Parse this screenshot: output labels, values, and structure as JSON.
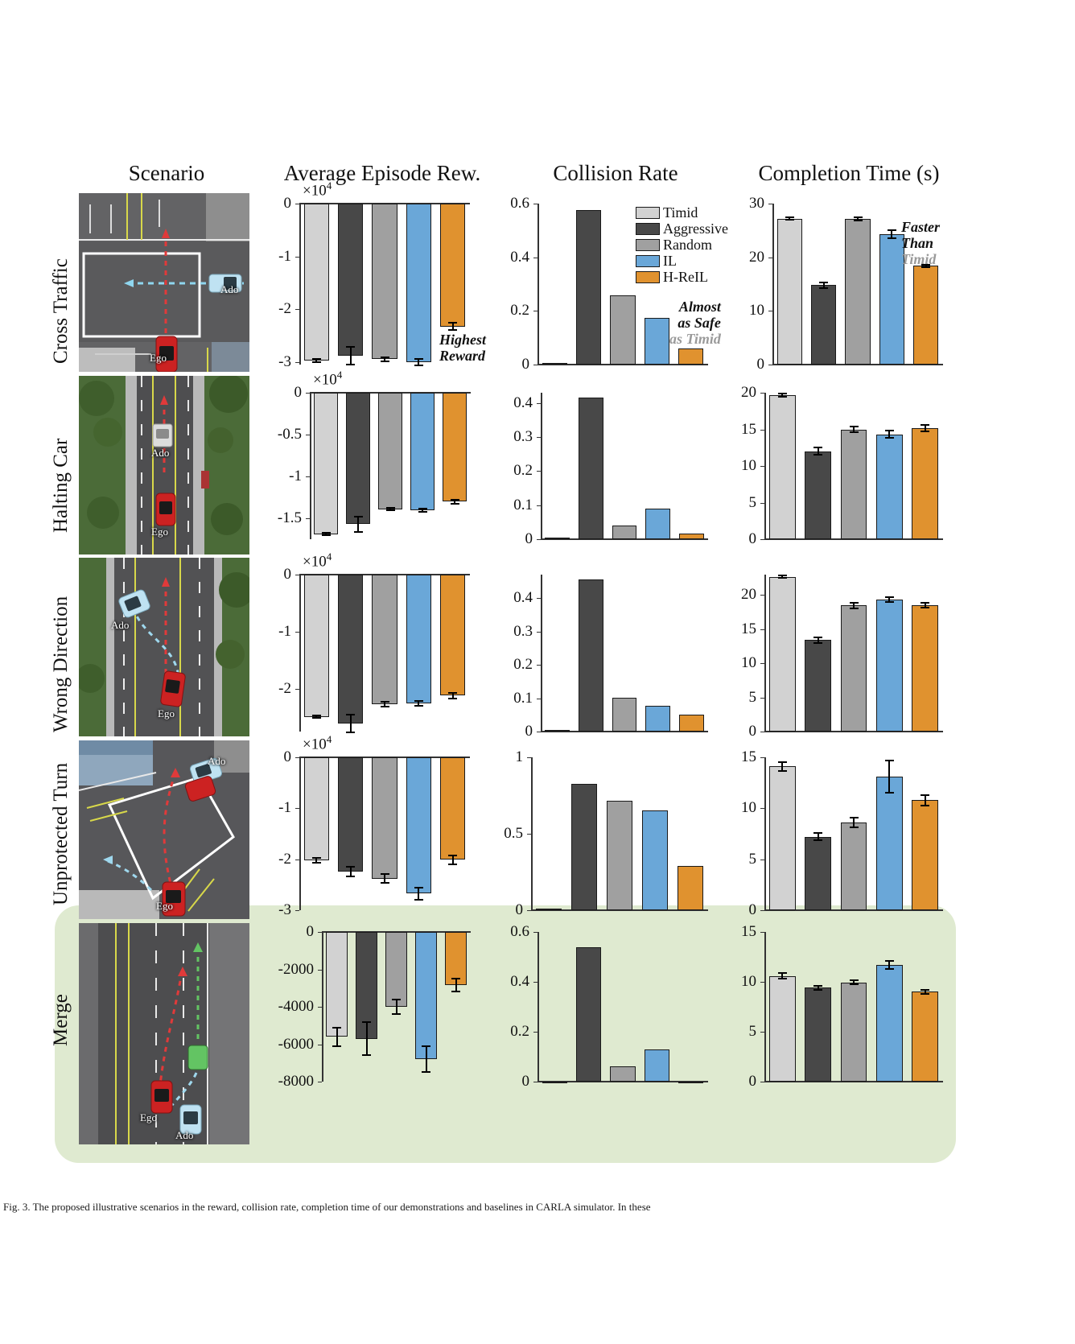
{
  "figure": {
    "caption": "Fig. 3.    The proposed illustrative scenarios in the reward, collision rate, completion time of our demonstrations and baselines in CARLA simulator. In these",
    "column_headers": [
      "Scenario",
      "Average Episode Rew.",
      "Collision Rate",
      "Completion Time (s)"
    ],
    "row_labels": [
      "Cross Traffic",
      "Halting Car",
      "Wrong Direction",
      "Unprotected Turn",
      "Merge"
    ],
    "highlight_color": "#dfead0"
  },
  "legend": {
    "position": "top-right of collision-rate panel row 1",
    "entries": [
      {
        "label": "Timid",
        "color": "#d2d2d2"
      },
      {
        "label": "Aggressive",
        "color": "#484848"
      },
      {
        "label": "Random",
        "color": "#a0a0a0"
      },
      {
        "label": "IL",
        "color": "#6aa7d8"
      },
      {
        "label": "H-ReIL",
        "color": "#e0922f"
      }
    ]
  },
  "scenarios": [
    {
      "name": "Cross Traffic",
      "ego_label": "Ego",
      "ado_label": "Ado"
    },
    {
      "name": "Halting Car",
      "ego_label": "Ego",
      "ado_label": "Ado"
    },
    {
      "name": "Wrong Direction",
      "ego_label": "Ego",
      "ado_label": "Ado"
    },
    {
      "name": "Unprotected Turn",
      "ego_label": "Ego",
      "ado_label": "Ado"
    },
    {
      "name": "Merge",
      "ego_label": "Ego",
      "ado_label": "Ado"
    }
  ],
  "annotations": [
    {
      "id": "highest-reward",
      "lines": [
        "Highest",
        "Reward"
      ],
      "dim_last": false
    },
    {
      "id": "almost-as-safe",
      "lines": [
        "Almost",
        "as Safe",
        "as Timid"
      ],
      "dim_last": true
    },
    {
      "id": "faster-than",
      "lines": [
        "Faster",
        "Than",
        "Timid"
      ],
      "dim_last": true
    }
  ],
  "chart_data": [
    {
      "type": "bar",
      "id": "reward-cross-traffic",
      "title": "Average Episode Rew.",
      "row": "Cross Traffic",
      "ylabel": "",
      "exponent": "×10⁴",
      "categories": [
        "Timid",
        "Aggressive",
        "Random",
        "IL",
        "H-ReIL"
      ],
      "values": [
        -29700,
        -28800,
        -29500,
        -30100,
        -23300
      ],
      "errors": [
        300,
        1700,
        350,
        600,
        700
      ],
      "ylim": [
        -30500,
        0
      ],
      "yticks": [
        0,
        -1,
        -2,
        -3
      ],
      "ytick_labels": [
        "0",
        "-1",
        "-2",
        "-3"
      ],
      "ytick_values": [
        0,
        -10000,
        -20000,
        -30000
      ],
      "grid": false
    },
    {
      "type": "bar",
      "id": "collision-cross-traffic",
      "title": "Collision Rate",
      "row": "Cross Traffic",
      "categories": [
        "Timid",
        "Aggressive",
        "Random",
        "IL",
        "H-ReIL"
      ],
      "values": [
        0.005,
        0.575,
        0.257,
        0.175,
        0.06
      ],
      "errors": [
        0,
        0,
        0,
        0,
        0
      ],
      "ylim": [
        0,
        0.6
      ],
      "yticks": [
        0,
        0.2,
        0.4,
        0.6
      ],
      "ytick_labels": [
        "0",
        "0.2",
        "0.4",
        "0.6"
      ],
      "grid": false
    },
    {
      "type": "bar",
      "id": "time-cross-traffic",
      "title": "Completion Time (s)",
      "row": "Cross Traffic",
      "categories": [
        "Timid",
        "Aggressive",
        "Random",
        "IL",
        "H-ReIL"
      ],
      "values": [
        27.2,
        14.8,
        27.2,
        24.3,
        18.4
      ],
      "errors": [
        0.25,
        0.55,
        0.3,
        0.8,
        0.25
      ],
      "ylim": [
        0,
        30
      ],
      "yticks": [
        0,
        10,
        20,
        30
      ],
      "ytick_labels": [
        "0",
        "10",
        "20",
        "30"
      ],
      "grid": false
    },
    {
      "type": "bar",
      "id": "reward-halting-car",
      "title": "Average Episode Rew.",
      "row": "Halting Car",
      "exponent": "×10⁴",
      "categories": [
        "Timid",
        "Aggressive",
        "Random",
        "IL",
        "H-ReIL"
      ],
      "values": [
        -16900,
        -15700,
        -13900,
        -14000,
        -13000
      ],
      "errors": [
        130,
        900,
        180,
        200,
        250
      ],
      "ylim": [
        -17500,
        0
      ],
      "yticks": [
        0,
        -0.5,
        -1,
        -1.5
      ],
      "ytick_labels": [
        "0",
        "-0.5",
        "-1",
        "-1.5"
      ],
      "ytick_values": [
        0,
        -5000,
        -10000,
        -15000
      ],
      "grid": false
    },
    {
      "type": "bar",
      "id": "collision-halting-car",
      "title": "Collision Rate",
      "row": "Halting Car",
      "categories": [
        "Timid",
        "Aggressive",
        "Random",
        "IL",
        "H-ReIL"
      ],
      "values": [
        0.004,
        0.415,
        0.04,
        0.09,
        0.017
      ],
      "ylim": [
        0,
        0.43
      ],
      "yticks": [
        0,
        0.1,
        0.2,
        0.3,
        0.4
      ],
      "ytick_labels": [
        "0",
        "0.1",
        "0.2",
        "0.3",
        "0.4"
      ],
      "grid": false
    },
    {
      "type": "bar",
      "id": "time-halting-car",
      "title": "Completion Time (s)",
      "row": "Halting Car",
      "categories": [
        "Timid",
        "Aggressive",
        "Random",
        "IL",
        "H-ReIL"
      ],
      "values": [
        19.7,
        12.0,
        15.0,
        14.3,
        15.2
      ],
      "errors": [
        0.2,
        0.5,
        0.35,
        0.5,
        0.45
      ],
      "ylim": [
        0,
        20
      ],
      "yticks": [
        0,
        5,
        10,
        15,
        20
      ],
      "ytick_labels": [
        "0",
        "5",
        "10",
        "15",
        "20"
      ],
      "grid": false
    },
    {
      "type": "bar",
      "id": "reward-wrong-direction",
      "title": "Average Episode Rew.",
      "row": "Wrong Direction",
      "exponent": "×10⁴",
      "categories": [
        "Timid",
        "Aggressive",
        "Random",
        "IL",
        "H-ReIL"
      ],
      "values": [
        -24900,
        -26100,
        -22700,
        -22600,
        -21200
      ],
      "errors": [
        250,
        1500,
        450,
        400,
        500
      ],
      "ylim": [
        -27500,
        0
      ],
      "yticks": [
        0,
        -1,
        -2
      ],
      "ytick_labels": [
        "0",
        "-1",
        "-2"
      ],
      "ytick_values": [
        0,
        -10000,
        -20000
      ],
      "grid": false
    },
    {
      "type": "bar",
      "id": "collision-wrong-direction",
      "title": "Collision Rate",
      "row": "Wrong Direction",
      "categories": [
        "Timid",
        "Aggressive",
        "Random",
        "IL",
        "H-ReIL"
      ],
      "values": [
        0.006,
        0.455,
        0.102,
        0.077,
        0.05
      ],
      "ylim": [
        0,
        0.47
      ],
      "yticks": [
        0,
        0.1,
        0.2,
        0.3,
        0.4
      ],
      "ytick_labels": [
        "0",
        "0.1",
        "0.2",
        "0.3",
        "0.4"
      ],
      "grid": false
    },
    {
      "type": "bar",
      "id": "time-wrong-direction",
      "title": "Completion Time (s)",
      "row": "Wrong Direction",
      "categories": [
        "Timid",
        "Aggressive",
        "Random",
        "IL",
        "H-ReIL"
      ],
      "values": [
        22.7,
        13.4,
        18.5,
        19.3,
        18.5
      ],
      "errors": [
        0.2,
        0.45,
        0.4,
        0.35,
        0.35
      ],
      "ylim": [
        0,
        23
      ],
      "yticks": [
        0,
        5,
        10,
        15,
        20
      ],
      "ytick_labels": [
        "0",
        "5",
        "10",
        "15",
        "20"
      ],
      "grid": false
    },
    {
      "type": "bar",
      "id": "reward-unprotected-turn",
      "title": "Average Episode Rew.",
      "row": "Unprotected Turn",
      "exponent": "×10⁴",
      "categories": [
        "Timid",
        "Aggressive",
        "Random",
        "IL",
        "H-ReIL"
      ],
      "values": [
        -20200,
        -22400,
        -23800,
        -26700,
        -20100
      ],
      "errors": [
        450,
        1000,
        900,
        1200,
        900
      ],
      "ylim": [
        -30000,
        0
      ],
      "yticks": [
        0,
        -1,
        -2,
        -3
      ],
      "ytick_labels": [
        "0",
        "-1",
        "-2",
        "-3"
      ],
      "ytick_values": [
        0,
        -10000,
        -20000,
        -30000
      ],
      "grid": false
    },
    {
      "type": "bar",
      "id": "collision-unprotected-turn",
      "title": "Collision Rate",
      "row": "Unprotected Turn",
      "categories": [
        "Timid",
        "Aggressive",
        "Random",
        "IL",
        "H-ReIL"
      ],
      "values": [
        0.008,
        0.825,
        0.715,
        0.655,
        0.29
      ],
      "ylim": [
        0,
        1
      ],
      "yticks": [
        0,
        0.5,
        1
      ],
      "ytick_labels": [
        "0",
        "0.5",
        "1"
      ],
      "grid": false
    },
    {
      "type": "bar",
      "id": "time-unprotected-turn",
      "title": "Completion Time (s)",
      "row": "Unprotected Turn",
      "categories": [
        "Timid",
        "Aggressive",
        "Random",
        "IL",
        "H-ReIL"
      ],
      "values": [
        14.1,
        7.2,
        8.6,
        13.1,
        10.8
      ],
      "errors": [
        0.45,
        0.35,
        0.5,
        1.6,
        0.5
      ],
      "ylim": [
        0,
        15
      ],
      "yticks": [
        0,
        5,
        10,
        15
      ],
      "ytick_labels": [
        "0",
        "5",
        "10",
        "15"
      ],
      "grid": false
    },
    {
      "type": "bar",
      "id": "reward-merge",
      "title": "Average Episode Rew.",
      "row": "Merge",
      "categories": [
        "Timid",
        "Aggressive",
        "Random",
        "IL",
        "H-ReIL"
      ],
      "values": [
        -5600,
        -5700,
        -4000,
        -6800,
        -2850
      ],
      "errors": [
        500,
        900,
        400,
        700,
        350
      ],
      "ylim": [
        -8000,
        0
      ],
      "yticks": [
        0,
        -2000,
        -4000,
        -6000,
        -8000
      ],
      "ytick_labels": [
        "0",
        "-2000",
        "-4000",
        "-6000",
        "-8000"
      ],
      "grid": false
    },
    {
      "type": "bar",
      "id": "collision-merge",
      "title": "Collision Rate",
      "row": "Merge",
      "categories": [
        "Timid",
        "Aggressive",
        "Random",
        "IL",
        "H-ReIL"
      ],
      "values": [
        0.0,
        0.54,
        0.06,
        0.13,
        0.0
      ],
      "ylim": [
        0,
        0.6
      ],
      "yticks": [
        0,
        0.2,
        0.4,
        0.6
      ],
      "ytick_labels": [
        "0",
        "0.2",
        "0.4",
        "0.6"
      ],
      "grid": false
    },
    {
      "type": "bar",
      "id": "time-merge",
      "title": "Completion Time (s)",
      "row": "Merge",
      "categories": [
        "Timid",
        "Aggressive",
        "Random",
        "IL",
        "H-ReIL"
      ],
      "values": [
        10.6,
        9.4,
        9.95,
        11.7,
        9.0
      ],
      "errors": [
        0.25,
        0.2,
        0.2,
        0.4,
        0.2
      ],
      "ylim": [
        0,
        15
      ],
      "yticks": [
        0,
        5,
        10,
        15
      ],
      "ytick_labels": [
        "0",
        "5",
        "10",
        "15"
      ],
      "grid": false
    }
  ]
}
